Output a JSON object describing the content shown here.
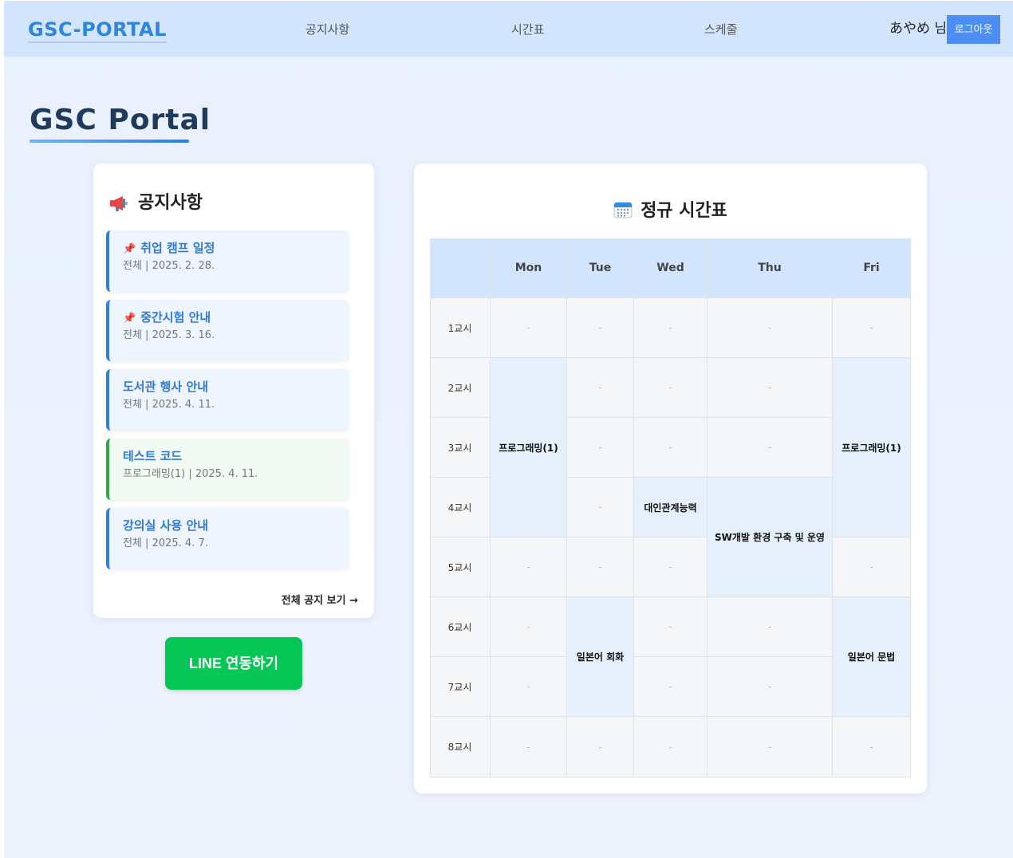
{
  "header": {
    "brand": "GSC-PORTAL",
    "nav": [
      "공지사항",
      "시간표",
      "스케줄"
    ],
    "user_name": "あやめ 님",
    "logout_label": "로그아웃"
  },
  "page_title": "GSC Portal",
  "notices": {
    "heading": "공지사항",
    "icon": "megaphone-icon",
    "items": [
      {
        "title": "취업 캠프 일정",
        "meta": "전체 | 2025. 2. 28.",
        "pinned": true
      },
      {
        "title": "중간시험 안내",
        "meta": "전체 | 2025. 3. 16.",
        "pinned": true
      },
      {
        "title": "도서관 행사 안내",
        "meta": "전체 | 2025. 4. 11.",
        "pinned": false
      },
      {
        "title": "테스트 코드",
        "meta": "프로그래밍(1) | 2025. 4. 11.",
        "pinned": false
      },
      {
        "title": "강의실 사용 안내",
        "meta": "전체 | 2025. 4. 7.",
        "pinned": false
      }
    ],
    "pin_icon": "📌",
    "view_all": "전체 공지 보기 →"
  },
  "line_button": "LINE 연동하기",
  "timetable": {
    "heading": "정규 시간표",
    "icon": "calendar-icon",
    "days": [
      "Mon",
      "Tue",
      "Wed",
      "Thu",
      "Fri"
    ],
    "periods": [
      "1교시",
      "2교시",
      "3교시",
      "4교시",
      "5교시",
      "6교시",
      "7교시",
      "8교시"
    ],
    "empty_mark": "-",
    "courses": {
      "mon_prog": "프로그래밍(1)",
      "fri_prog": "프로그래밍(1)",
      "wed_interpersonal": "대인관계능력",
      "thu_sw": "SW개발 환경 구축 및 운영",
      "tue_japanese": "일본어 회화",
      "fri_japanese": "일본어 문법"
    }
  }
}
